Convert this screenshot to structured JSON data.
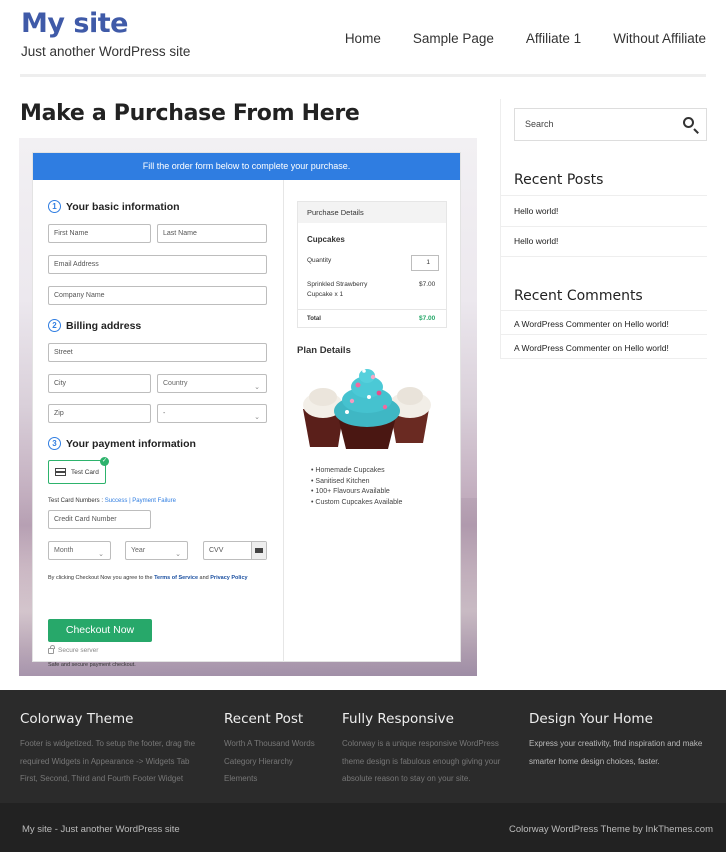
{
  "header": {
    "site_title": "My site",
    "tagline": "Just another WordPress site",
    "nav": [
      "Home",
      "Sample Page",
      "Affiliate 1",
      "Without Affiliate"
    ]
  },
  "main": {
    "page_title": "Make a Purchase From Here",
    "form": {
      "banner": "Fill the order form below to complete your purchase.",
      "step1": {
        "num": "1",
        "title": "Your basic information"
      },
      "first_name": "First Name",
      "last_name": "Last Name",
      "email": "Email Address",
      "company": "Company Name",
      "step2": {
        "num": "2",
        "title": "Billing address"
      },
      "street": "Street",
      "city": "City",
      "country": "Country",
      "zip": "Zip",
      "state": "-",
      "step3": {
        "num": "3",
        "title": "Your payment information"
      },
      "test_card": "Test Card",
      "test_card_numbers": "Test Card Numbers :",
      "success": "Success",
      "sep": "|",
      "payment_failure": "Payment Failure",
      "card_number": "Credit Card Number",
      "month": "Month",
      "year": "Year",
      "cvv": "CVV",
      "terms_prefix": "By clicking Checkout Now you agree to the",
      "terms_link": "Terms of Service",
      "and": "and",
      "privacy_link": "Privacy Policy",
      "checkout_btn": "Checkout Now",
      "secure": "Secure server",
      "safe": "Safe and secure payment checkout."
    },
    "purchase": {
      "heading": "Purchase Details",
      "product": "Cupcakes",
      "quantity_label": "Quantity",
      "quantity": "1",
      "item_line1": "Sprinkled Strawberry",
      "item_line2": "Cupcake x 1",
      "item_price": "$7.00",
      "total_label": "Total",
      "total": "$7.00"
    },
    "plan": {
      "title": "Plan Details",
      "features": [
        "Homemade Cupcakes",
        "Sanitised Kitchen",
        "100+ Flavours Available",
        "Custom Cupcakes Available"
      ]
    }
  },
  "sidebar": {
    "search_placeholder": "Search",
    "recent_posts_title": "Recent Posts",
    "posts": [
      "Hello world!",
      "Hello world!"
    ],
    "recent_comments_title": "Recent Comments",
    "comments": [
      {
        "author": "A WordPress Commenter",
        "on": "on",
        "post": "Hello world!"
      },
      {
        "author": "A WordPress Commenter",
        "on": "on",
        "post": "Hello world!"
      }
    ]
  },
  "footer": {
    "cols": [
      {
        "title": "Colorway Theme",
        "lines": [
          "Footer is widgetized. To setup the footer, drag the",
          "required Widgets in Appearance -> Widgets Tab",
          "First, Second, Third and Fourth Footer Widget"
        ]
      },
      {
        "title": "Recent Post",
        "lines": [
          "Worth A Thousand Words",
          "Category Hierarchy",
          "Elements"
        ]
      },
      {
        "title": "Fully Responsive",
        "lines": [
          "Colorway is a unique responsive WordPress",
          "theme design is fabulous enough giving your",
          "absolute reason to stay on your site."
        ]
      },
      {
        "title": "Design Your Home",
        "lines": [
          "Express your creativity, find inspiration and make",
          "smarter home design choices, faster."
        ]
      }
    ],
    "bottom_left": "My site - Just another WordPress site",
    "bottom_right": "Colorway WordPress Theme by InkThemes.com"
  },
  "colors": {
    "brand": "#3f5aa8",
    "banner": "#2f7de1",
    "checkout": "#27a86a",
    "total": "#27a86a",
    "footer": "#2b2b2b"
  }
}
